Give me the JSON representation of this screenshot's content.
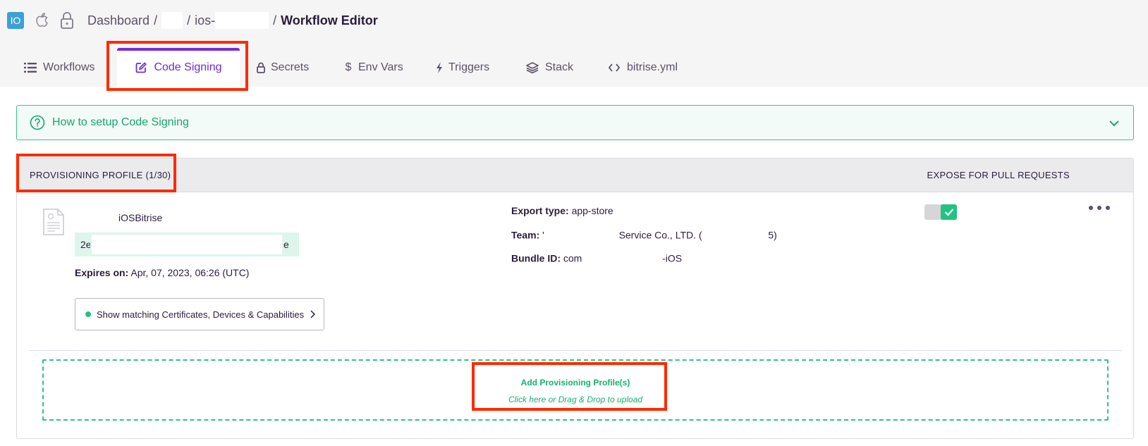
{
  "app": {
    "badge": "IO"
  },
  "breadcrumb": {
    "dashboard": "Dashboard",
    "separator": "/",
    "project_prefix": "ios-",
    "current": "Workflow Editor"
  },
  "tabs": [
    {
      "label": "Workflows",
      "icon": "list-icon"
    },
    {
      "label": "Code Signing",
      "icon": "edit-square-icon",
      "active": true
    },
    {
      "label": "Secrets",
      "icon": "lock-icon"
    },
    {
      "label": "Env Vars",
      "icon": "dollar-icon"
    },
    {
      "label": "Triggers",
      "icon": "bolt-icon"
    },
    {
      "label": "Stack",
      "icon": "layers-icon"
    },
    {
      "label": "bitrise.yml",
      "icon": "code-icon"
    }
  ],
  "help": {
    "label": "How to setup Code Signing",
    "icon": "question-circle-icon"
  },
  "panel": {
    "title": "PROVISIONING PROFILE (1/30)",
    "expose_label": "EXPOSE FOR PULL REQUESTS"
  },
  "profile": {
    "name": "iOSBitrise",
    "uuid_prefix": "2e",
    "uuid_suffix": "e",
    "expires_label": "Expires on:",
    "expires_value": "Apr, 07, 2023, 06:26 (UTC)",
    "match_button": "Show matching Certificates, Devices & Capabilities",
    "export_label": "Export type:",
    "export_value": "app-store",
    "team_label": "Team:",
    "team_value_a": "'",
    "team_value_b": "Service Co., LTD. (",
    "team_value_c": "5)",
    "bundle_label": "Bundle ID:",
    "bundle_value_a": "com",
    "bundle_value_b": "-iOS",
    "expose_enabled": true
  },
  "dropzone": {
    "title": "Add Provisioning Profile(s)",
    "subtitle": "Click here or Drag & Drop to upload"
  },
  "colors": {
    "accent": "#6c2bd9",
    "green": "#22c381",
    "highlight": "#ff2a00"
  }
}
